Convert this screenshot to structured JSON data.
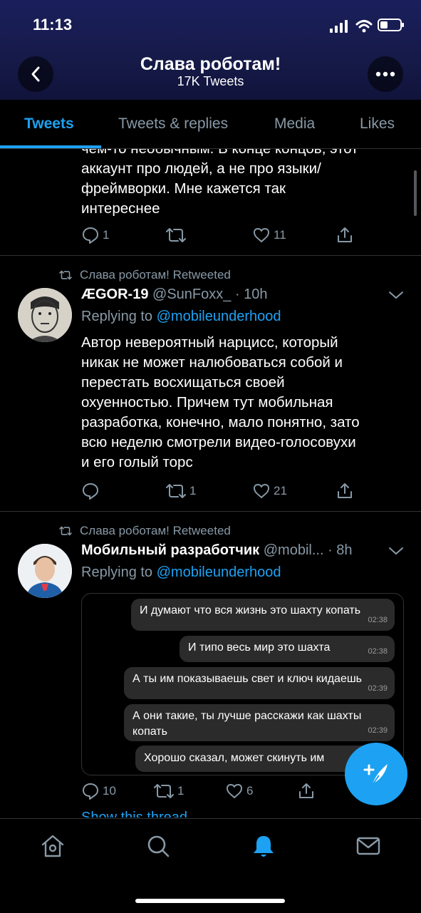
{
  "status_bar": {
    "time": "11:13"
  },
  "profile": {
    "name": "Слава роботам!",
    "tweet_count": "17K Tweets"
  },
  "tabs": [
    {
      "label": "Tweets",
      "active": true
    },
    {
      "label": "Tweets & replies"
    },
    {
      "label": "Media"
    },
    {
      "label": "Likes"
    }
  ],
  "tweets": [
    {
      "text_lines": [
        "чем-то необычным. В конце концов, этот",
        "аккаунт про людей, а не про языки/",
        "фреймворки. Мне кажется так",
        "интереснее"
      ],
      "replies": "1",
      "retweets": "",
      "likes": "11"
    },
    {
      "retweeted_by": "Слава роботам! Retweeted",
      "name": "ÆGOR-19",
      "handle": "@SunFoxx_ · 10h",
      "replying_prefix": "Replying to",
      "replying_to": "@mobileunderhood",
      "text_lines": [
        "Автор невероятный нарцисс, который",
        "никак не может налюбоваться собой и",
        "перестать восхищаться своей",
        "охуенностью. Причем тут мобильная",
        "разработка, конечно, мало понятно, зато",
        "всю неделю смотрели видео-голосовухи",
        "и его голый торс"
      ],
      "replies": "",
      "retweets": "1",
      "likes": "21"
    },
    {
      "retweeted_by": "Слава роботам! Retweeted",
      "name": "Мобильный разработчик",
      "handle": "@mobil... · 8h",
      "replying_prefix": "Replying to",
      "replying_to": "@mobileunderhood",
      "chat": [
        {
          "text": "И думают что вся жизнь это шахту копать",
          "time": "02:38"
        },
        {
          "text": "И типо весь мир это шахта",
          "time": "02:38"
        },
        {
          "text": "А ты им показываешь свет и ключ кидаешь",
          "time": "02:39"
        },
        {
          "text": "А они такие, ты лучше расскажи как шахты",
          "text2": "копать",
          "time": "02:39"
        },
        {
          "text": "Хорошо сказал, может скинуть им",
          "time": ""
        }
      ],
      "replies": "10",
      "retweets": "1",
      "likes": "6",
      "show_thread": "Show this thread"
    }
  ],
  "colors": {
    "accent": "#1da1f2",
    "muted": "#8899a6",
    "header_bg": "#161a48",
    "bubble": "#2b2b2b"
  },
  "bottom_nav": [
    "home-icon",
    "search-icon",
    "notifications-bell-icon",
    "messages-icon"
  ]
}
